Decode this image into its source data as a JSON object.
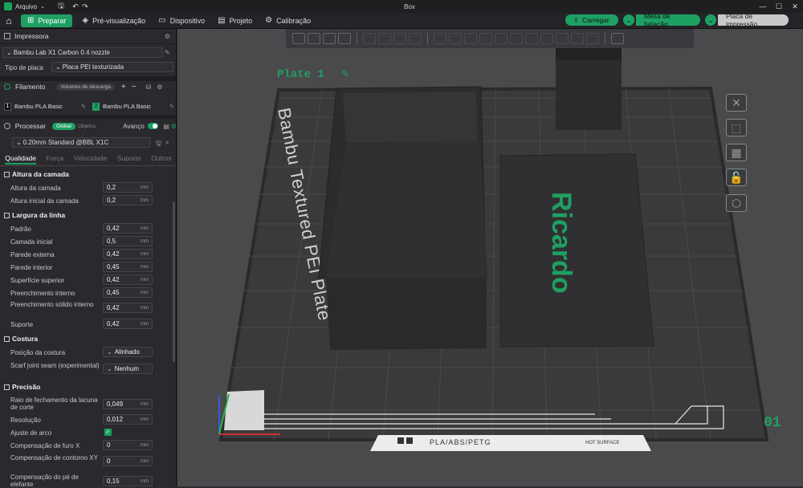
{
  "window": {
    "menu_label": "Arquivo",
    "doc_title": "Box"
  },
  "tabs": [
    {
      "label": "Preparar"
    },
    {
      "label": "Pré-visualização"
    },
    {
      "label": "Dispositivo"
    },
    {
      "label": "Projeto"
    },
    {
      "label": "Calibração"
    }
  ],
  "actions": {
    "load": "Carregar",
    "slice_table": "Mesa de fatiação",
    "print_plate": "Placa de impressão"
  },
  "printer": {
    "section": "Impressora",
    "model": "Bambu Lab X1 Carbon 0.4 nozzle",
    "plate_type_label": "Tipo de placa",
    "plate_type": "Placa PEI texturizada"
  },
  "filament": {
    "section": "Filamento",
    "pill": "Volumes de descarga",
    "slots": [
      {
        "num": "1",
        "name": "Bambu PLA Basic",
        "color": "#111111"
      },
      {
        "num": "2",
        "name": "Bambu PLA Basic",
        "color": "#1ea063"
      }
    ]
  },
  "process": {
    "section": "Processar",
    "pill_global": "Global",
    "pill_objects": "Objetos",
    "advanced_label": "Avanço",
    "preset": "0.20mm Standard @BBL X1C",
    "subtabs": [
      "Qualidade",
      "Força",
      "Velocidade",
      "Suporte",
      "Outros"
    ]
  },
  "settings": {
    "g1": "Altura da camada",
    "l1": "Altura da camada",
    "v1": "0,2",
    "l2": "Altura inicial da camada",
    "v2": "0,2",
    "g2": "Largura da linha",
    "l3": "Padrão",
    "v3": "0,42",
    "l4": "Camada inicial",
    "v4": "0,5",
    "l5": "Parede externa",
    "v5": "0,42",
    "l6": "Parede interior",
    "v6": "0,45",
    "l7": "Superfície superior",
    "v7": "0,42",
    "l8": "Preenchimento interno",
    "v8": "0,45",
    "l9": "Preenchimento sólido interno",
    "v9": "0,42",
    "l10": "Suporte",
    "v10": "0,42",
    "g3": "Costura",
    "l11": "Posição da costura",
    "v11": "Alinhado",
    "l12": "Scarf joint seam (experimental)",
    "v12": "Nenhum",
    "g4": "Precisão",
    "l13": "Raio de fechamento da lacuna de corte",
    "v13": "0,049",
    "l14": "Resolução",
    "v14": "0,012",
    "l15": "Ajuste de arco",
    "l16": "Compensação de furo X",
    "v16": "0",
    "l17": "Compensação de contorno XY",
    "v17": "0",
    "l18": "Compensação do pé de elefante",
    "v18": "0,15",
    "unit": "mm"
  },
  "scene": {
    "plate_name": "Plate 1",
    "bed_text": "Bambu Textured PEI Plate",
    "object_text": "Ricardo",
    "plate_number": "01",
    "bed_strip": "PLA/ABS/PETG",
    "hot_surface": "HOT SURFACE",
    "text_color": "#1ea063"
  }
}
